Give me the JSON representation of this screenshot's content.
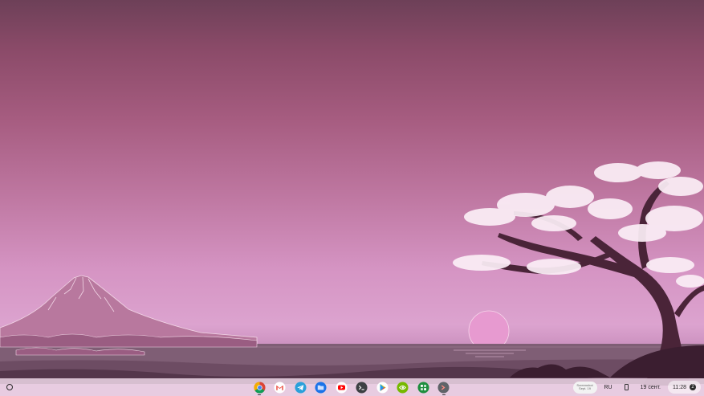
{
  "shelf": {
    "launcher_icon": "launcher-circle-icon",
    "apps": [
      {
        "name": "Chrome",
        "icon": "chrome-icon",
        "running": true
      },
      {
        "name": "Gmail",
        "icon": "gmail-icon",
        "running": false
      },
      {
        "name": "Telegram",
        "icon": "telegram-icon",
        "running": false
      },
      {
        "name": "Files",
        "icon": "folder-icon",
        "running": false
      },
      {
        "name": "YouTube",
        "icon": "youtube-icon",
        "running": false
      },
      {
        "name": "Terminal",
        "icon": "terminal-icon",
        "running": false
      },
      {
        "name": "Play Store",
        "icon": "play-store-icon",
        "running": false
      },
      {
        "name": "NVIDIA GeForce Now",
        "icon": "nvidia-icon",
        "running": false
      },
      {
        "name": "Green app",
        "icon": "green-app-icon",
        "running": false
      },
      {
        "name": "Crostini Terminal",
        "icon": "terminal-prompt-icon",
        "running": true
      }
    ],
    "holding_space": {
      "line1": "Screenshot",
      "line2": "Sept. 19"
    },
    "ime": "RU",
    "date": "19 сент.",
    "time": "11:28",
    "notification_count": "2"
  },
  "colors": {
    "sky_top": "#6d4058",
    "sky_mid": "#bf78a2",
    "sky_bottom": "#dca3cf",
    "sun": "#e79ad0",
    "water": "#7f5e75",
    "tree_trunk": "#4a2438",
    "blossom": "#fbeef6"
  }
}
